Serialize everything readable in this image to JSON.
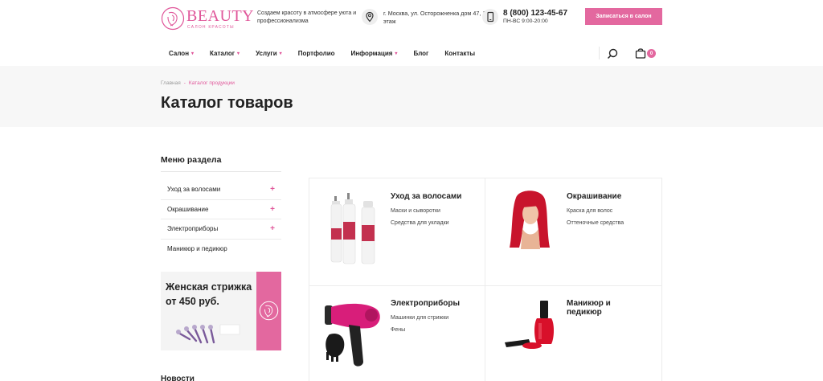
{
  "header": {
    "logo_word": "BEAUTY",
    "logo_sub": "САЛОН КРАСОТЫ",
    "tagline": "Создаем красоту в атмосфере уюта и профессионализма",
    "address": "г. Москва, ул. Осторожненка дом 47, 1 этаж",
    "phone": "8 (800) 123-45-67",
    "hours": "ПН-ВС 9:00-20:00",
    "cta_label": "Записаться в салон",
    "accent": "#e3689f"
  },
  "nav": {
    "items": [
      {
        "label": "Салон",
        "dropdown": true
      },
      {
        "label": "Каталог",
        "dropdown": true
      },
      {
        "label": "Услуги",
        "dropdown": true
      },
      {
        "label": "Портфолио",
        "dropdown": false
      },
      {
        "label": "Информация",
        "dropdown": true
      },
      {
        "label": "Блог",
        "dropdown": false
      },
      {
        "label": "Контакты",
        "dropdown": false
      }
    ],
    "cart_count": "0",
    "search_icon": "search-icon",
    "cart_icon": "shopping-bag-icon"
  },
  "breadcrumb": {
    "home": "Главная",
    "separator": "-",
    "current": "Каталог продукции"
  },
  "page_title": "Каталог товаров",
  "sidebar": {
    "title": "Меню раздела",
    "items": [
      {
        "label": "Уход за волосами",
        "expandable": true
      },
      {
        "label": "Окрашивание",
        "expandable": true
      },
      {
        "label": "Электроприборы",
        "expandable": true
      },
      {
        "label": "Маникюр и педикюр",
        "expandable": false
      }
    ],
    "promo_text": "Женская стрижка от 450 руб.",
    "news_title": "Новости"
  },
  "catalog": {
    "cards": [
      {
        "title": "Уход за волосами",
        "links": [
          "Маски и сыворотки",
          "Средства для укладки"
        ],
        "image": "hair-care-bottles"
      },
      {
        "title": "Окрашивание",
        "links": [
          "Краска для волос",
          "Оттеночные средства"
        ],
        "image": "red-haired-woman"
      },
      {
        "title": "Электроприборы",
        "links": [
          "Машинки для стрижки",
          "Фены"
        ],
        "image": "hair-dryer"
      },
      {
        "title": "Маникюр и педикюр",
        "links": [],
        "image": "nail-polish"
      }
    ]
  }
}
